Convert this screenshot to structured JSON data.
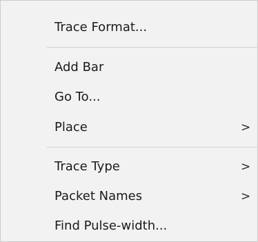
{
  "context_menu": {
    "items": [
      {
        "label": "Trace Format...",
        "has_submenu": false
      },
      {
        "label": "Add Bar",
        "has_submenu": false
      },
      {
        "label": "Go To...",
        "has_submenu": false
      },
      {
        "label": "Place",
        "has_submenu": true,
        "arrow": ">"
      },
      {
        "label": "Trace Type",
        "has_submenu": true,
        "arrow": ">"
      },
      {
        "label": "Packet Names",
        "has_submenu": true,
        "arrow": ">"
      },
      {
        "label": "Find Pulse-width...",
        "has_submenu": false
      }
    ]
  }
}
